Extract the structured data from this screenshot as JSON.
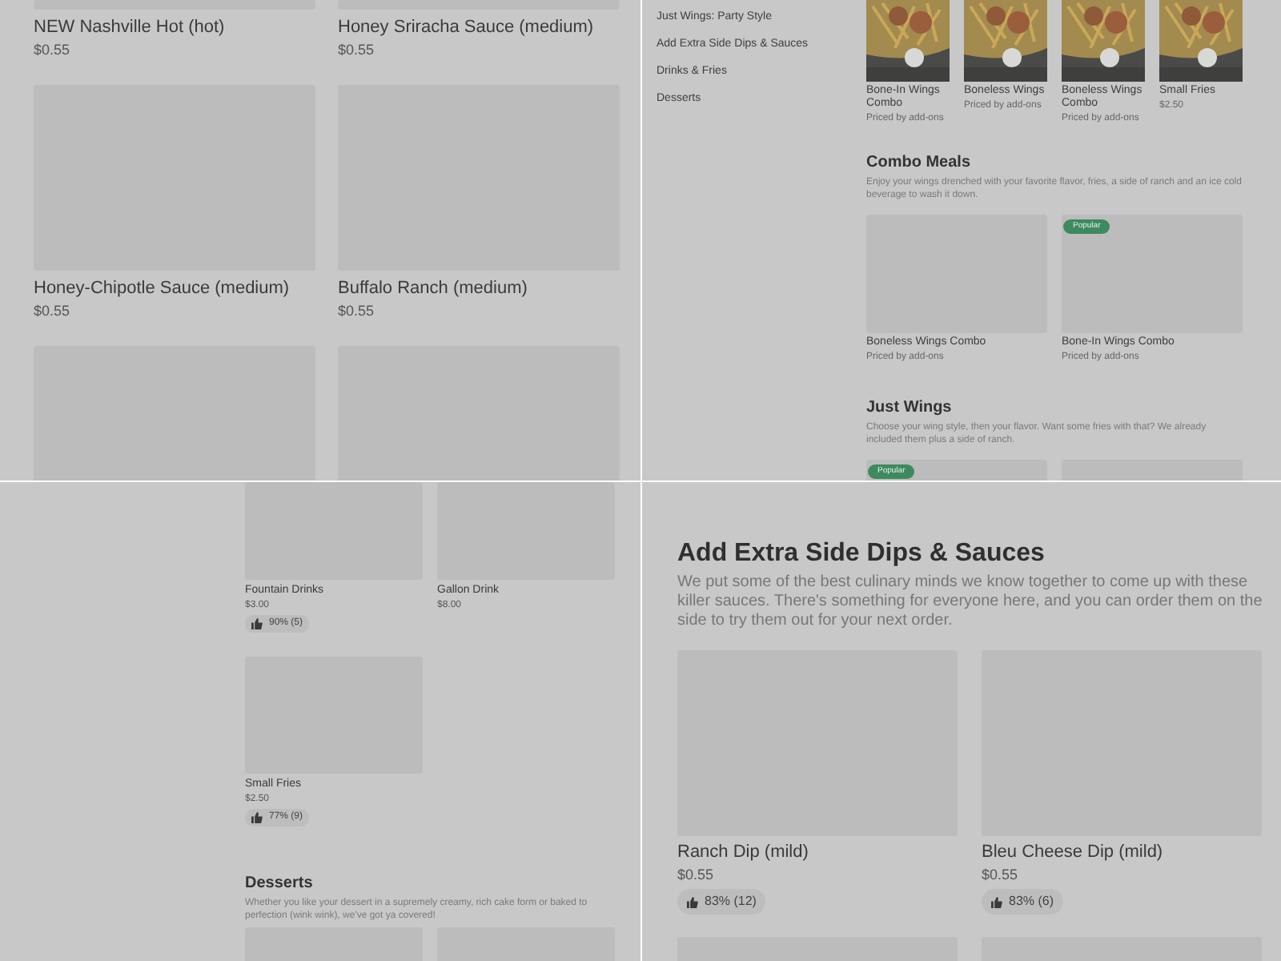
{
  "panel_sauces": {
    "items": [
      {
        "name": "NEW Nashville Hot (hot)",
        "price": "$0.55"
      },
      {
        "name": "Honey Sriracha Sauce (medium)",
        "price": "$0.55"
      },
      {
        "name": "Honey-Chipotle Sauce (medium)",
        "price": "$0.55"
      },
      {
        "name": "Buffalo Ranch (medium)",
        "price": "$0.55"
      },
      {
        "kind": "picture"
      },
      {
        "kind": "picture"
      }
    ]
  },
  "panel_menu": {
    "sidebar": {
      "items": [
        {
          "label": "Just Wings: Party Style"
        },
        {
          "label": "Add Extra Side Dips & Sauces"
        },
        {
          "label": "Drinks & Fries"
        },
        {
          "label": "Desserts"
        }
      ]
    },
    "featured": [
      {
        "name": "Bone-In Wings Combo",
        "price": "Priced by add-ons"
      },
      {
        "name": "Boneless Wings",
        "price": "Priced by add-ons"
      },
      {
        "name": "Boneless Wings Combo",
        "price": "Priced by add-ons"
      },
      {
        "name": "Small Fries",
        "price": "$2.50"
      }
    ],
    "sections": [
      {
        "title": "Combo Meals",
        "description": "Enjoy your wings drenched with your favorite flavor, fries, a side of ranch and an ice cold beverage to wash it down.",
        "items": [
          {
            "name": "Boneless Wings Combo",
            "price": "Priced by add-ons"
          },
          {
            "name": "Bone-In Wings Combo",
            "price": "Priced by add-ons",
            "badge": "Popular"
          }
        ]
      },
      {
        "title": "Just Wings",
        "description": "Choose your wing style, then your flavor. Want some fries with that? We already included them plus a side of ranch.",
        "items": [
          {
            "badge": "Popular"
          },
          {
            "kind": "picture"
          }
        ]
      }
    ]
  },
  "panel_drinks": {
    "items": [
      {
        "name": "Fountain Drinks",
        "price": "$3.00",
        "rating": "90% (5)"
      },
      {
        "name": "Gallon Drink",
        "price": "$8.00"
      },
      {
        "name": "Small Fries",
        "price": "$2.50",
        "rating": "77% (9)"
      }
    ],
    "section": {
      "title": "Desserts",
      "description": "Whether you like your dessert in a supremely creamy, rich cake form or baked to perfection (wink wink), we've got ya covered!",
      "items": [
        {
          "kind": "picture"
        },
        {
          "kind": "picture"
        }
      ]
    }
  },
  "panel_dips": {
    "title": "Add Extra Side Dips & Sauces",
    "description": "We put some of the best culinary minds we know together to come up with these killer sauces. There's something for everyone here, and you can order them on the side to try them out for your next order.",
    "items": [
      {
        "name": "Ranch Dip (mild)",
        "price": "$0.55",
        "rating": "83% (12)"
      },
      {
        "name": "Bleu Cheese Dip (mild)",
        "price": "$0.55",
        "rating": "83% (6)"
      },
      {
        "kind": "picture"
      },
      {
        "kind": "picture"
      }
    ]
  }
}
